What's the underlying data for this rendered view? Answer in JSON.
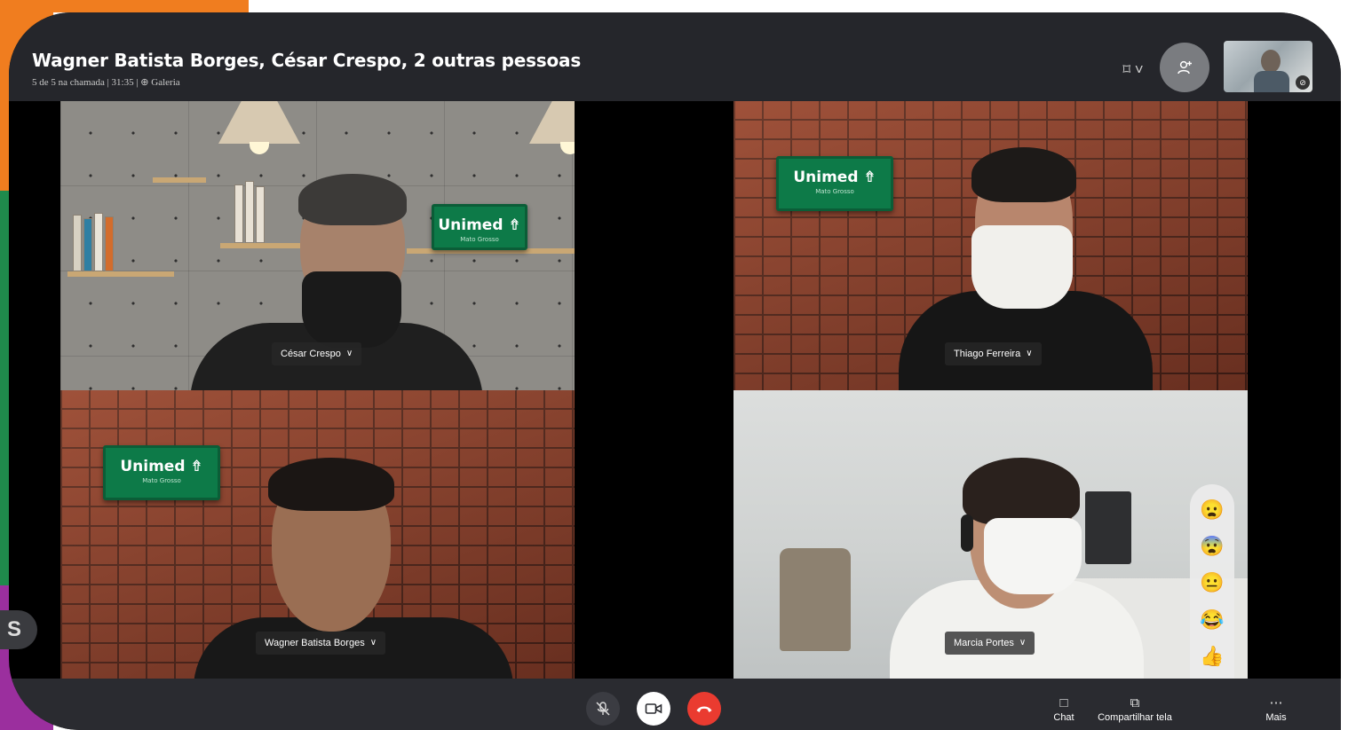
{
  "window": {
    "title": "Wagner Batista Borges, César Crespo, 2 outras pessoas",
    "subtitle": "5 de 5 na chamada | 31:35 | ⊕ Galeria"
  },
  "header_icons": {
    "layout": "layout-icon",
    "add_people": "add-people-icon"
  },
  "participants": [
    {
      "name": "César Crespo",
      "background": "concrete-shelf",
      "sign_text": "Unimed",
      "sign_sub": "Mato Grosso"
    },
    {
      "name": "Thiago Ferreira",
      "background": "brick",
      "sign_text": "Unimed",
      "sign_sub": "Mato Grosso"
    },
    {
      "name": "Wagner Batista Borges",
      "background": "brick",
      "sign_text": "Unimed",
      "sign_sub": "Mato Grosso"
    },
    {
      "name": "Marcia Portes",
      "background": "office"
    }
  ],
  "sign": {
    "brand": "Unimed ⇮",
    "region": "Mato Grosso"
  },
  "reactions": [
    "😦",
    "😨",
    "😐",
    "😂",
    "👍",
    "❤️"
  ],
  "controls": {
    "chat_label": "Chat",
    "share_label": "Compartilhar tela",
    "more_label": "Mais",
    "chat_icon": "□",
    "share_icon": "⧉",
    "more_icon": "⋯"
  },
  "side_tab": "S",
  "colors": {
    "bar": "#2a2b30",
    "end_call": "#ea3b30",
    "brand_green": "#0d7a48",
    "edge_orange": "#f07d1f",
    "edge_green": "#1f8a4c",
    "edge_purple": "#9b2f9e"
  }
}
